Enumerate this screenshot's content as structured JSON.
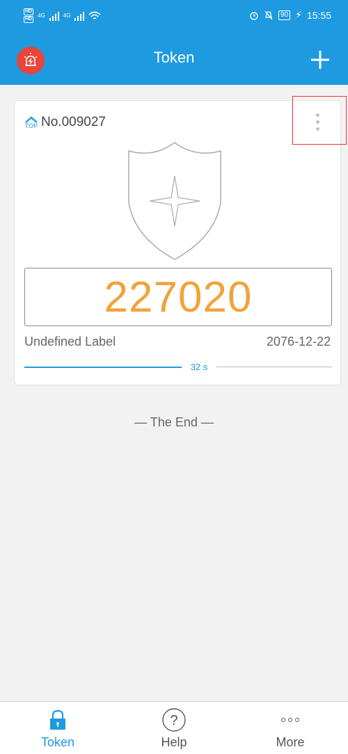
{
  "status_bar": {
    "hd_label": "HD",
    "network_1": "4G",
    "network_2": "4G",
    "battery": "90",
    "time": "15:55"
  },
  "header": {
    "title": "Token",
    "left_icon": "alarm-icon",
    "right_icon": "plus-icon"
  },
  "token_card": {
    "top_badge": "TOP",
    "number": "No.009027",
    "code": "227020",
    "label": "Undefined Label",
    "date": "2076-12-22",
    "countdown": "32 s",
    "progress_fraction": 0.5,
    "menu_icon": "more-vertical-icon"
  },
  "list_end": "— The End —",
  "bottom_nav": {
    "tabs": [
      {
        "label": "Token",
        "icon": "lock-icon",
        "active": true
      },
      {
        "label": "Help",
        "icon": "help-circle-icon",
        "active": false
      },
      {
        "label": "More",
        "icon": "more-horizontal-icon",
        "active": false
      }
    ]
  },
  "colors": {
    "accent": "#1e9ae0",
    "code": "#f0a33a",
    "alarm": "#e8453c",
    "highlight": "#e33333"
  }
}
